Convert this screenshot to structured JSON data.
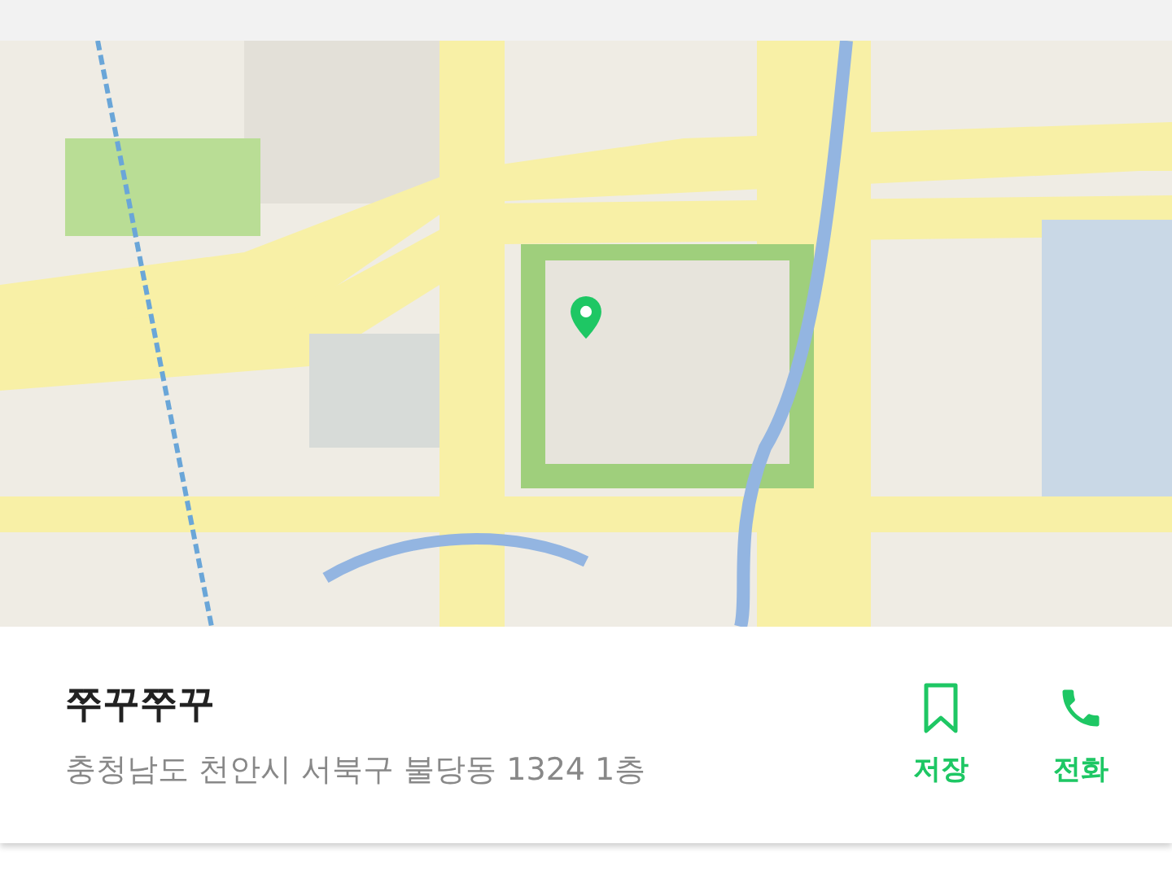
{
  "place": {
    "name": "쭈꾸쭈꾸",
    "address": "충청남도 천안시 서북구 불당동 1324 1층"
  },
  "actions": [
    {
      "kind": "save",
      "label": "저장"
    },
    {
      "kind": "call",
      "label": "전화"
    }
  ]
}
